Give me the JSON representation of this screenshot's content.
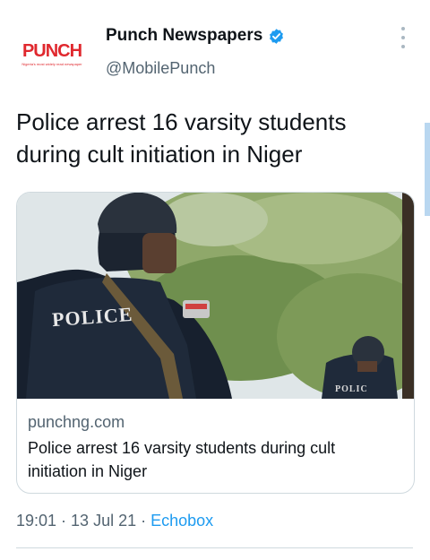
{
  "account": {
    "logo_text": "PUNCH",
    "logo_tagline": "Nigeria's most widely read newspaper",
    "display_name": "Punch Newspapers",
    "handle": "@MobilePunch"
  },
  "tweet": {
    "text": "Police arrest 16 varsity students during cult initiation in Niger"
  },
  "card": {
    "image_text_1": "POLICE",
    "image_text_2": "POLIC",
    "domain": "punchng.com",
    "title": "Police arrest 16 varsity students during cult initiation in Niger"
  },
  "meta": {
    "time": "19:01",
    "sep1": " · ",
    "date": "13 Jul 21",
    "sep2": " · ",
    "source": "Echobox"
  },
  "colors": {
    "brand_red": "#e0282e",
    "verified_blue": "#1d9bf0",
    "secondary_text": "#536471"
  }
}
